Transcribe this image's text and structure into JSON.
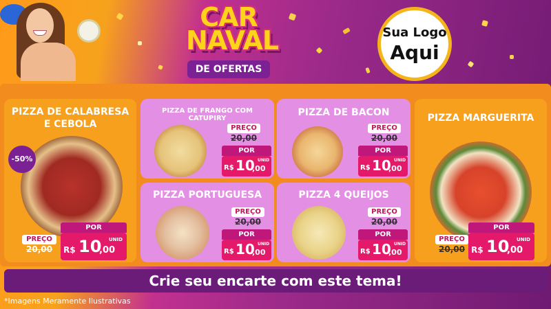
{
  "header": {
    "title_line1": "CAR",
    "title_line2": "NAVAL",
    "subtitle": "DE OFERTAS",
    "logo_line1": "Sua Logo",
    "logo_line2": "Aqui"
  },
  "currency": "R$",
  "old_price": "20,00",
  "new_price_int": "10",
  "new_price_cents": ",00",
  "preco_label": "PREÇO",
  "por_label": "POR",
  "unid_label": "UNID",
  "badge": "-50%",
  "products": [
    {
      "name": "PIZZA DE CALABRESA E CEBOLA"
    },
    {
      "name": "PIZZA DE FRANGO COM CATUPIRY"
    },
    {
      "name": "PIZZA DE BACON"
    },
    {
      "name": "PIZZA MARGUERITA"
    },
    {
      "name": "PIZZA PORTUGUESA"
    },
    {
      "name": "PIZZA 4 QUEIJOS"
    }
  ],
  "banner": "Crie seu encarte com este tema!",
  "footnote": "*Imagens Meramente Ilustrativas",
  "colors": {
    "orange": "#f28c1f",
    "purple": "#6a1c78",
    "pink_card": "#e38fe4",
    "price_red": "#e5196a"
  }
}
